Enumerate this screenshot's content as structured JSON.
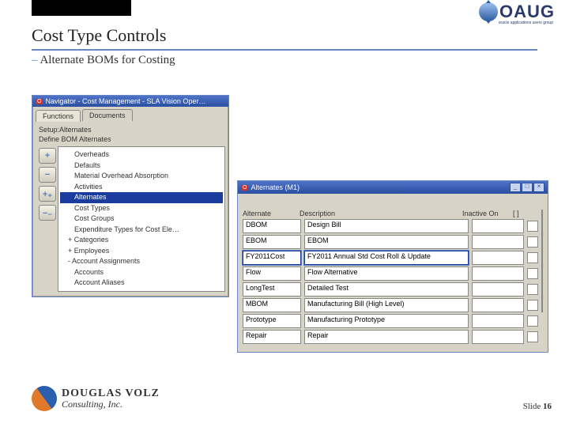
{
  "header": {
    "oaug": "OAUG",
    "oaug_tag": "oracle applications users group",
    "title": "Cost Type Controls",
    "subtitle": "Alternate BOMs for Costing"
  },
  "navigator": {
    "window_title": "Navigator - Cost Management - SLA Vision Oper…",
    "tabs": {
      "functions": "Functions",
      "documents": "Documents"
    },
    "breadcrumb_line1": "Setup:Alternates",
    "breadcrumb_line2": "Define BOM Alternates",
    "side_buttons": {
      "plus": "+",
      "minus": "−",
      "dplus": "+₊",
      "dminus": "−₋"
    },
    "tree": [
      {
        "label": "Overheads",
        "level": 3
      },
      {
        "label": "Defaults",
        "level": 3
      },
      {
        "label": "Material Overhead Absorption",
        "level": 3
      },
      {
        "label": "Activities",
        "level": 3
      },
      {
        "label": "Alternates",
        "level": 3,
        "selected": true
      },
      {
        "label": "Cost Types",
        "level": 3
      },
      {
        "label": "Cost Groups",
        "level": 3
      },
      {
        "label": "Expenditure Types for Cost Ele…",
        "level": 3
      },
      {
        "label": "Categories",
        "level": 2,
        "prefix": "+"
      },
      {
        "label": "Employees",
        "level": 2,
        "prefix": "+"
      },
      {
        "label": "Account Assignments",
        "level": 2,
        "prefix": "-"
      },
      {
        "label": "Accounts",
        "level": 3
      },
      {
        "label": "Account Aliases",
        "level": 3
      }
    ]
  },
  "alternates": {
    "window_title": "Alternates (M1)",
    "columns": {
      "alternate": "Alternate",
      "description": "Description",
      "inactive": "Inactive On",
      "flag": "[  ]"
    },
    "rows": [
      {
        "alt": "DBOM",
        "desc": "Design Bill",
        "inact": "",
        "selected": false
      },
      {
        "alt": "EBOM",
        "desc": "EBOM",
        "inact": "",
        "selected": false
      },
      {
        "alt": "FY2011Cost",
        "desc": "FY2011 Annual Std Cost Roll & Update",
        "inact": "",
        "selected": true
      },
      {
        "alt": "Flow",
        "desc": "Flow Alternative",
        "inact": "",
        "selected": false
      },
      {
        "alt": "LongTest",
        "desc": "Detailed Test",
        "inact": "",
        "selected": false
      },
      {
        "alt": "MBOM",
        "desc": "Manufacturing Bill (High Level)",
        "inact": "",
        "selected": false
      },
      {
        "alt": "Prototype",
        "desc": "Manufacturing Prototype",
        "inact": "",
        "selected": false
      },
      {
        "alt": "Repair",
        "desc": "Repair",
        "inact": "",
        "selected": false
      }
    ]
  },
  "footer": {
    "logo_line1": "DOUGLAS VOLZ",
    "logo_line2": "Consulting, Inc.",
    "slide_label": "Slide",
    "slide_number": "16"
  }
}
